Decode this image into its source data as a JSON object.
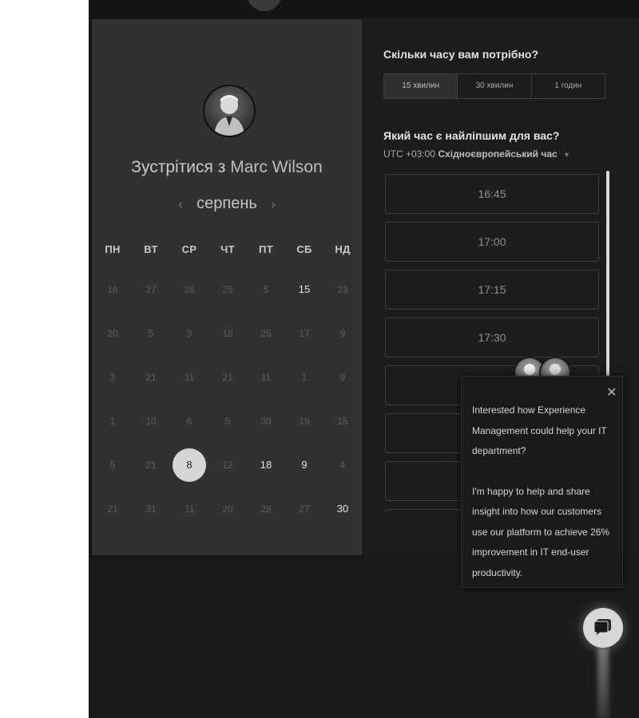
{
  "header": {
    "logo_icon": "brand-logo-icon"
  },
  "calendar": {
    "title_prefix": "Зустрітися з",
    "host_name": "Marc Wilson",
    "month_label": "серпень",
    "prev_icon": "‹",
    "next_icon": "›",
    "weekdays": [
      "ПН",
      "ВТ",
      "СР",
      "ЧТ",
      "ПТ",
      "СБ",
      "НД"
    ],
    "weeks": [
      [
        {
          "d": "16",
          "s": "off"
        },
        {
          "d": "27",
          "s": "off"
        },
        {
          "d": "28",
          "s": "off"
        },
        {
          "d": "25",
          "s": "off"
        },
        {
          "d": "5",
          "s": "off"
        },
        {
          "d": "15",
          "s": "avail"
        },
        {
          "d": "23",
          "s": "off"
        }
      ],
      [
        {
          "d": "20",
          "s": "off"
        },
        {
          "d": "5",
          "s": "off"
        },
        {
          "d": "3",
          "s": "off"
        },
        {
          "d": "18",
          "s": "off"
        },
        {
          "d": "25",
          "s": "off"
        },
        {
          "d": "17",
          "s": "off"
        },
        {
          "d": "9",
          "s": "off"
        }
      ],
      [
        {
          "d": "3",
          "s": "off"
        },
        {
          "d": "21",
          "s": "off"
        },
        {
          "d": "11",
          "s": "off"
        },
        {
          "d": "21",
          "s": "off"
        },
        {
          "d": "11",
          "s": "off"
        },
        {
          "d": "1",
          "s": "off"
        },
        {
          "d": "9",
          "s": "off"
        }
      ],
      [
        {
          "d": "1",
          "s": "off"
        },
        {
          "d": "10",
          "s": "off"
        },
        {
          "d": "6",
          "s": "off"
        },
        {
          "d": "5",
          "s": "off"
        },
        {
          "d": "30",
          "s": "off"
        },
        {
          "d": "19",
          "s": "off"
        },
        {
          "d": "15",
          "s": "off"
        }
      ],
      [
        {
          "d": "5",
          "s": "off"
        },
        {
          "d": "21",
          "s": "off"
        },
        {
          "d": "8",
          "s": "selected"
        },
        {
          "d": "12",
          "s": "off"
        },
        {
          "d": "18",
          "s": "avail"
        },
        {
          "d": "9",
          "s": "avail"
        },
        {
          "d": "4",
          "s": "off"
        }
      ],
      [
        {
          "d": "21",
          "s": "off"
        },
        {
          "d": "31",
          "s": "off"
        },
        {
          "d": "11",
          "s": "off"
        },
        {
          "d": "20",
          "s": "off"
        },
        {
          "d": "28",
          "s": "off"
        },
        {
          "d": "27",
          "s": "off"
        },
        {
          "d": "30",
          "s": "avail"
        }
      ]
    ]
  },
  "duration": {
    "question": "Скільки часу вам потрібно?",
    "options": [
      "15 хвилин",
      "30 хвилин",
      "1 годин"
    ],
    "selected_index": 0
  },
  "times": {
    "question": "Який час є найліпшим для вас?",
    "tz_offset": "UTC +03:00",
    "tz_name": "Східноєвропейський час",
    "caret_icon": "▼",
    "slots": [
      "16:45",
      "17:00",
      "17:15",
      "17:30",
      "",
      "",
      "",
      ""
    ]
  },
  "chat": {
    "close_label": "✕",
    "message_1": "Interested how Experience Management could help your IT department?",
    "message_2": "I'm happy to help and share insight into how our customers use our platform to achieve 26% improvement in IT end-user productivity.",
    "launcher_icon": "chat-bubble-icon"
  },
  "colors": {
    "page_bg": "#1b1b1b",
    "panel_bg": "#313131",
    "selected_day": "#d6d6d6",
    "launcher": "#d7d7d7"
  }
}
